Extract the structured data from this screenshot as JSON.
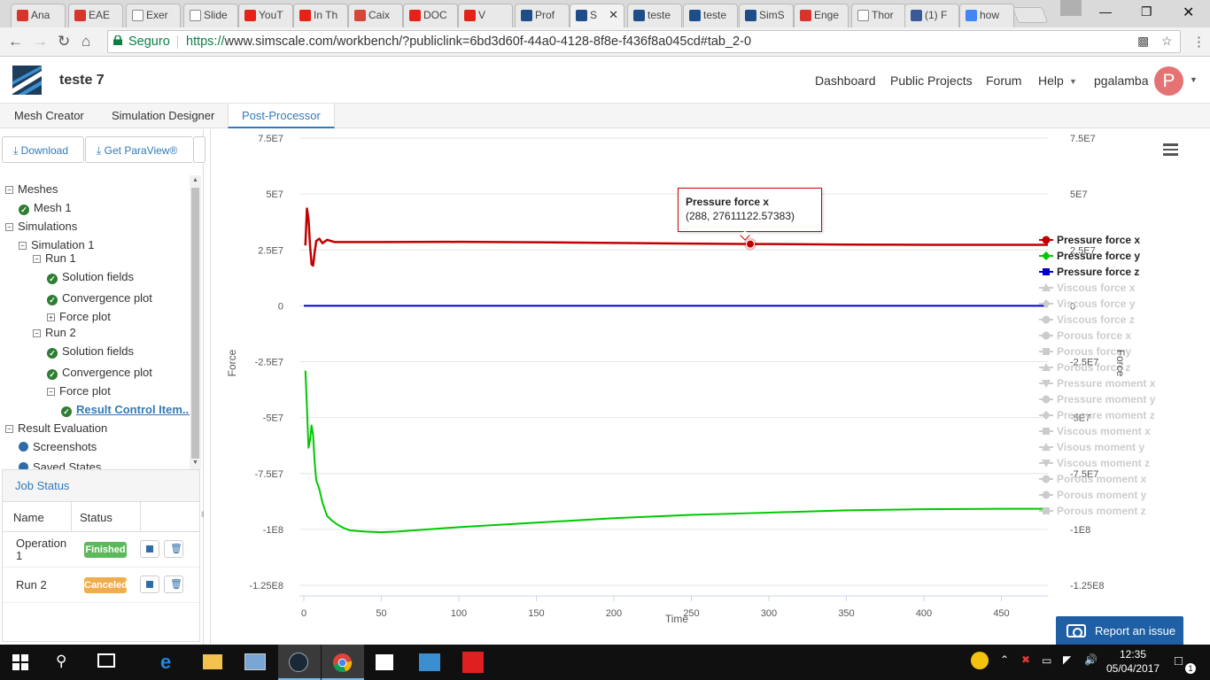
{
  "browser": {
    "tabs": [
      {
        "label": "Ana",
        "favicon": "isel-icon",
        "color": "#d9342b"
      },
      {
        "label": "EAE",
        "favicon": "isel-icon",
        "color": "#d9342b"
      },
      {
        "label": "Exer",
        "favicon": "document-icon",
        "color": "#ffffff"
      },
      {
        "label": "Slide",
        "favicon": "document-icon",
        "color": "#ffffff"
      },
      {
        "label": "YouT",
        "favicon": "youtube-icon",
        "color": "#e62117"
      },
      {
        "label": "In Th",
        "favicon": "youtube-icon",
        "color": "#e62117"
      },
      {
        "label": "Caix",
        "favicon": "gmail-icon",
        "color": "#d44638"
      },
      {
        "label": "DOC",
        "favicon": "youtube-icon",
        "color": "#e62117"
      },
      {
        "label": "V",
        "favicon": "youtube-icon",
        "color": "#e62117"
      },
      {
        "label": "Prof",
        "favicon": "simscale-icon",
        "color": "#1d4e89"
      },
      {
        "label": "S",
        "favicon": "simscale-icon",
        "color": "#1d4e89",
        "active": true
      },
      {
        "label": "teste",
        "favicon": "simscale-icon",
        "color": "#1d4e89"
      },
      {
        "label": "teste",
        "favicon": "simscale-icon",
        "color": "#1d4e89"
      },
      {
        "label": "SimS",
        "favicon": "simscale-icon",
        "color": "#1d4e89"
      },
      {
        "label": "Enge",
        "favicon": "isel-icon",
        "color": "#d9342b"
      },
      {
        "label": "Thor",
        "favicon": "document-icon",
        "color": "#ffffff"
      },
      {
        "label": "(1) F",
        "favicon": "facebook-icon",
        "color": "#3b5998"
      },
      {
        "label": "how",
        "favicon": "google-icon",
        "color": "#4285f4"
      }
    ],
    "secure_label": "Seguro",
    "url_scheme": "https://",
    "url_rest": "www.simscale.com/workbench/?publiclink=6bd3d60f-44a0-4128-8f8e-f436f8a045cd#tab_2-0"
  },
  "app": {
    "project_title": "teste 7",
    "nav": {
      "dashboard": "Dashboard",
      "public_projects": "Public Projects",
      "forum": "Forum",
      "help": "Help",
      "username": "pgalamba",
      "avatar_letter": "P"
    },
    "subtabs": {
      "mesh_creator": "Mesh Creator",
      "simulation_designer": "Simulation Designer",
      "post_processor": "Post-Processor"
    },
    "buttons": {
      "download": "Download",
      "paraview": "Get ParaView®"
    },
    "tree": {
      "meshes": "Meshes",
      "mesh1": "Mesh 1",
      "simulations": "Simulations",
      "simulation1": "Simulation 1",
      "run1": "Run 1",
      "run1_solution_fields": "Solution fields",
      "run1_convergence_plot": "Convergence plot",
      "run1_force_plot": "Force plot",
      "run2": "Run 2",
      "run2_solution_fields": "Solution fields",
      "run2_convergence_plot": "Convergence plot",
      "run2_force_plot": "Force plot",
      "result_control_items": "Result Control Item...",
      "result_evaluation": "Result Evaluation",
      "screenshots": "Screenshots",
      "saved_states": "Saved States"
    },
    "job_status": {
      "title": "Job Status",
      "col_name": "Name",
      "col_status": "Status",
      "rows": [
        {
          "name_line1": "Operation",
          "name_line2": "1",
          "status": "Finished",
          "color": "#5cb85c"
        },
        {
          "name_line1": "Run 2",
          "name_line2": "",
          "status": "Canceled",
          "color": "#f0ad4e"
        }
      ]
    },
    "report_issue": "Report an issue"
  },
  "chart_data": {
    "type": "line",
    "xlabel": "Time",
    "ylabel": "Force",
    "ylabel_right": "Force",
    "xlim": [
      0,
      480
    ],
    "ylim": [
      -125000000,
      75000000
    ],
    "xticks": [
      0,
      50,
      100,
      150,
      200,
      250,
      300,
      350,
      400,
      450
    ],
    "yticks": [
      75000000,
      50000000,
      25000000,
      0,
      -25000000,
      -50000000,
      -75000000,
      -100000000,
      -125000000
    ],
    "ytick_labels": [
      "7.5E7",
      "5E7",
      "2.5E7",
      "0",
      "-2.5E7",
      "-5E7",
      "-7.5E7",
      "-1E8",
      "-1.25E8"
    ],
    "grid": true,
    "legend_position": "right",
    "series": [
      {
        "name": "Pressure force x",
        "color": "#c00000",
        "visible": true,
        "marker": "circle",
        "x": [
          1,
          2,
          3,
          4,
          5,
          6,
          7,
          8,
          10,
          12,
          15,
          20,
          30,
          50,
          100,
          150,
          200,
          250,
          288,
          300,
          350,
          400,
          450,
          480
        ],
        "y": [
          27000000,
          43500000,
          39000000,
          27000000,
          18500000,
          18000000,
          24000000,
          29000000,
          30000000,
          28000000,
          29500000,
          28500000,
          28500000,
          28500000,
          28600000,
          28400000,
          28100000,
          27800000,
          27611122.57383,
          27600000,
          27400000,
          27300000,
          27300000,
          27300000
        ]
      },
      {
        "name": "Pressure force y",
        "color": "#00c800",
        "visible": true,
        "marker": "diamond",
        "x": [
          1,
          2,
          3,
          4,
          5,
          6,
          7,
          8,
          10,
          12,
          15,
          18,
          22,
          26,
          30,
          40,
          50,
          60,
          80,
          100,
          150,
          200,
          250,
          300,
          350,
          400,
          450,
          480
        ],
        "y": [
          -29000000,
          -45000000,
          -63500000,
          -60000000,
          -53500000,
          -58000000,
          -70000000,
          -78000000,
          -82000000,
          -88000000,
          -94000000,
          -96000000,
          -98000000,
          -99500000,
          -100500000,
          -101000000,
          -101300000,
          -101000000,
          -100000000,
          -99000000,
          -97000000,
          -95000000,
          -93500000,
          -92500000,
          -91500000,
          -91000000,
          -90800000,
          -90800000
        ]
      },
      {
        "name": "Pressure force z",
        "color": "#0000c8",
        "visible": true,
        "marker": "square",
        "x": [
          0,
          480
        ],
        "y": [
          0,
          0
        ]
      },
      {
        "name": "Viscous force x",
        "visible": false,
        "marker": "triangle"
      },
      {
        "name": "Viscous force y",
        "visible": false,
        "marker": "diamond"
      },
      {
        "name": "Viscous force z",
        "visible": false,
        "marker": "circle"
      },
      {
        "name": "Porous force x",
        "visible": false,
        "marker": "circle"
      },
      {
        "name": "Porous force y",
        "visible": false,
        "marker": "square"
      },
      {
        "name": "Porous force z",
        "visible": false,
        "marker": "triangle"
      },
      {
        "name": "Pressure moment x",
        "visible": false,
        "marker": "triangle-down"
      },
      {
        "name": "Pressure moment y",
        "visible": false,
        "marker": "circle"
      },
      {
        "name": "Pressure moment z",
        "visible": false,
        "marker": "diamond"
      },
      {
        "name": "Viscous moment x",
        "visible": false,
        "marker": "square"
      },
      {
        "name": "Visous moment y",
        "visible": false,
        "marker": "triangle"
      },
      {
        "name": "Viscous moment z",
        "visible": false,
        "marker": "triangle-down"
      },
      {
        "name": "Porous moment x",
        "visible": false,
        "marker": "circle"
      },
      {
        "name": "Porous moment y",
        "visible": false,
        "marker": "circle"
      },
      {
        "name": "Porous moment z",
        "visible": false,
        "marker": "square"
      }
    ],
    "hidden_color": "#cccccc",
    "tooltip": {
      "series": "Pressure force x",
      "x": 288,
      "y": 27611122.57383,
      "text": "(288, 27611122.57383)"
    }
  },
  "taskbar": {
    "time": "12:35",
    "date": "05/04/2017",
    "notification_count": "1"
  }
}
